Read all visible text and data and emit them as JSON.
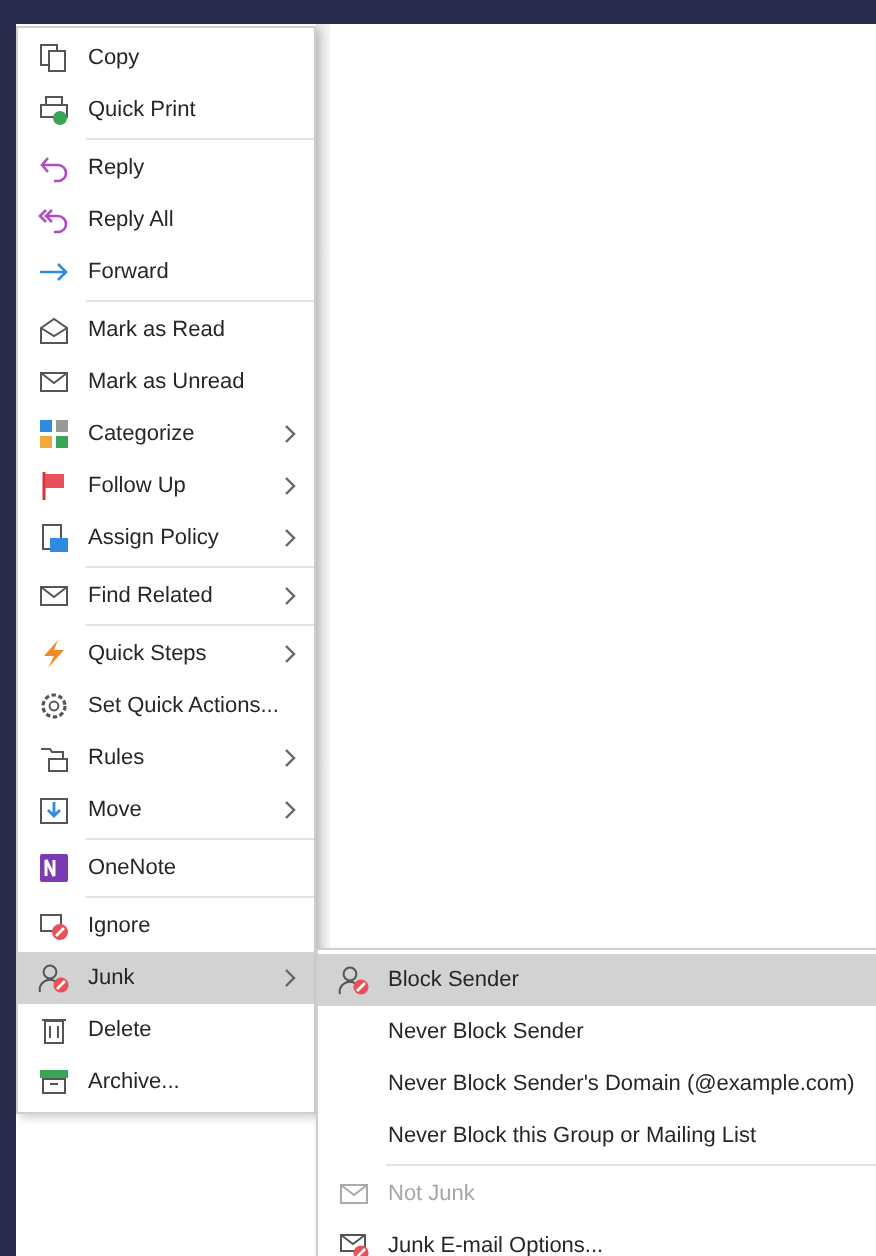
{
  "context_menu": {
    "items": [
      {
        "kind": "item",
        "label": "Copy",
        "submenu": false,
        "selected": false
      },
      {
        "kind": "item",
        "label": "Quick Print",
        "submenu": false,
        "selected": false
      },
      {
        "kind": "separator"
      },
      {
        "kind": "item",
        "label": "Reply",
        "submenu": false,
        "selected": false
      },
      {
        "kind": "item",
        "label": "Reply All",
        "submenu": false,
        "selected": false
      },
      {
        "kind": "item",
        "label": "Forward",
        "submenu": false,
        "selected": false
      },
      {
        "kind": "separator"
      },
      {
        "kind": "item",
        "label": "Mark as Read",
        "submenu": false,
        "selected": false
      },
      {
        "kind": "item",
        "label": "Mark as Unread",
        "submenu": false,
        "selected": false
      },
      {
        "kind": "item",
        "label": "Categorize",
        "submenu": true,
        "selected": false
      },
      {
        "kind": "item",
        "label": "Follow Up",
        "submenu": true,
        "selected": false
      },
      {
        "kind": "item",
        "label": "Assign Policy",
        "submenu": true,
        "selected": false
      },
      {
        "kind": "separator"
      },
      {
        "kind": "item",
        "label": "Find Related",
        "submenu": true,
        "selected": false
      },
      {
        "kind": "separator"
      },
      {
        "kind": "item",
        "label": "Quick Steps",
        "submenu": true,
        "selected": false
      },
      {
        "kind": "item",
        "label": "Set Quick Actions...",
        "submenu": false,
        "selected": false
      },
      {
        "kind": "item",
        "label": "Rules",
        "submenu": true,
        "selected": false
      },
      {
        "kind": "item",
        "label": "Move",
        "submenu": true,
        "selected": false
      },
      {
        "kind": "separator"
      },
      {
        "kind": "item",
        "label": "OneNote",
        "submenu": false,
        "selected": false
      },
      {
        "kind": "separator"
      },
      {
        "kind": "item",
        "label": "Ignore",
        "submenu": false,
        "selected": false
      },
      {
        "kind": "item",
        "label": "Junk",
        "submenu": true,
        "selected": true
      },
      {
        "kind": "item",
        "label": "Delete",
        "submenu": false,
        "selected": false
      },
      {
        "kind": "item",
        "label": "Archive...",
        "submenu": false,
        "selected": false
      }
    ]
  },
  "junk_submenu": {
    "items": [
      {
        "kind": "item",
        "label": "Block Sender",
        "disabled": false,
        "selected": true
      },
      {
        "kind": "item",
        "label": "Never Block Sender",
        "disabled": false,
        "selected": false
      },
      {
        "kind": "item",
        "label": "Never Block Sender's Domain (@example.com)",
        "disabled": false,
        "selected": false
      },
      {
        "kind": "item",
        "label": "Never Block this Group or Mailing List",
        "disabled": false,
        "selected": false
      },
      {
        "kind": "separator"
      },
      {
        "kind": "item",
        "label": "Not Junk",
        "disabled": true,
        "selected": false
      },
      {
        "kind": "item",
        "label": "Junk E-mail Options...",
        "disabled": false,
        "selected": false
      }
    ]
  }
}
